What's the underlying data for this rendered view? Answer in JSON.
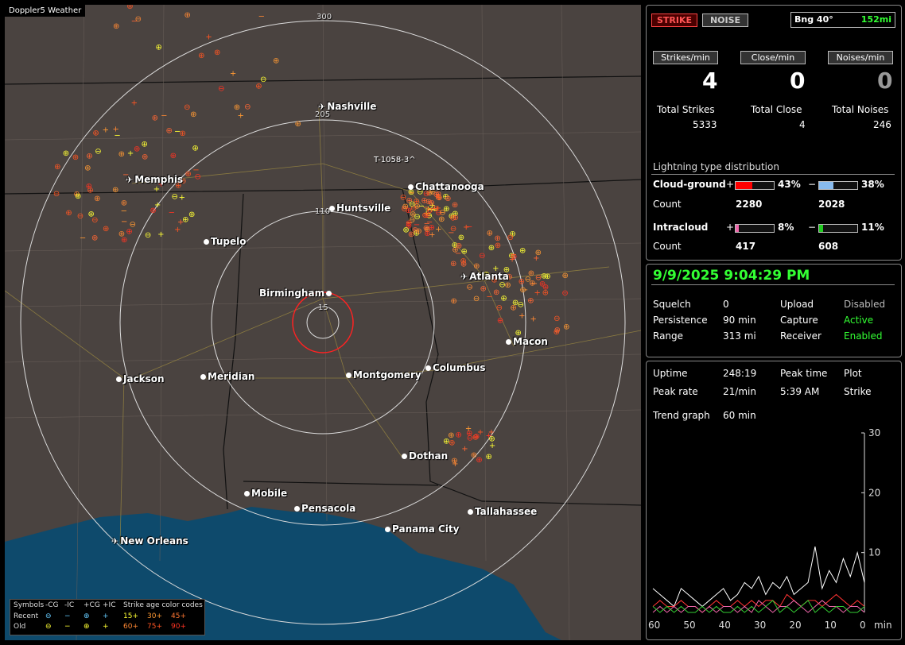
{
  "app_title": "Doppler5 Weather",
  "map": {
    "rings": [
      "300",
      "205",
      "110",
      "15"
    ],
    "marker_label": "T-1058-3^",
    "cities": [
      {
        "name": "Nashville",
        "type": "airport"
      },
      {
        "name": "Memphis",
        "type": "airport"
      },
      {
        "name": "Chattanooga",
        "type": "city"
      },
      {
        "name": "Huntsville",
        "type": "city"
      },
      {
        "name": "Tupelo",
        "type": "city"
      },
      {
        "name": "Atlanta",
        "type": "airport"
      },
      {
        "name": "Birmingham",
        "type": "city"
      },
      {
        "name": "Macon",
        "type": "city"
      },
      {
        "name": "Jackson",
        "type": "city"
      },
      {
        "name": "Meridian",
        "type": "city"
      },
      {
        "name": "Montgomery",
        "type": "city"
      },
      {
        "name": "Columbus",
        "type": "city"
      },
      {
        "name": "Dothan",
        "type": "city"
      },
      {
        "name": "Mobile",
        "type": "city"
      },
      {
        "name": "Pensacola",
        "type": "city"
      },
      {
        "name": "Tallahassee",
        "type": "city"
      },
      {
        "name": "Panama City",
        "type": "city"
      },
      {
        "name": "New Orleans",
        "type": "airport"
      }
    ]
  },
  "legend": {
    "title_symbols": "Symbols",
    "cols": [
      "-CG",
      "-IC",
      "+CG",
      "+IC"
    ],
    "title_age": "Strike age color codes",
    "recent": "Recent",
    "old": "Old",
    "recent_ages": [
      "15+",
      "30+",
      "45+"
    ],
    "old_ages": [
      "60+",
      "75+",
      "90+"
    ],
    "age_colors": [
      "#ffff33",
      "#ff9933",
      "#ff6633",
      "#ff8833",
      "#ff5522",
      "#ff3322"
    ]
  },
  "status": {
    "strike_label": "STRIKE",
    "noise_label": "NOISE",
    "bearing_label": "Bng 40°",
    "bearing_distance": "152mi"
  },
  "rates": {
    "strikes_label": "Strikes/min",
    "close_label": "Close/min",
    "noises_label": "Noises/min",
    "strikes": "4",
    "close": "0",
    "noises": "0"
  },
  "totals": {
    "strikes_label": "Total Strikes",
    "close_label": "Total Close",
    "noises_label": "Total Noises",
    "strikes": "5333",
    "close": "4",
    "noises": "246"
  },
  "distribution": {
    "title": "Lightning type distribution",
    "cg_label": "Cloud-ground",
    "ic_label": "Intracloud",
    "count_label": "Count",
    "plus": "+",
    "minus": "−",
    "cg_plus_pct": "43%",
    "cg_minus_pct": "38%",
    "cg_plus_count": "2280",
    "cg_minus_count": "2028",
    "ic_plus_pct": "8%",
    "ic_minus_pct": "11%",
    "ic_plus_count": "417",
    "ic_minus_count": "608",
    "colors": {
      "cg_plus": "#ff0000",
      "cg_minus": "#88bbee",
      "ic_plus": "#ee66aa",
      "ic_minus": "#22cc22"
    }
  },
  "settings": {
    "datetime": "9/9/2025 9:04:29 PM",
    "squelch_label": "Squelch",
    "squelch": "0",
    "persistence_label": "Persistence",
    "persistence": "90 min",
    "range_label": "Range",
    "range": "313 mi",
    "upload_label": "Upload",
    "upload": "Disabled",
    "capture_label": "Capture",
    "capture": "Active",
    "receiver_label": "Receiver",
    "receiver": "Enabled"
  },
  "stats": {
    "uptime_label": "Uptime",
    "uptime": "248:19",
    "peak_time_label": "Peak time",
    "plot_label": "Plot",
    "peak_rate_label": "Peak rate",
    "peak_rate": "21/min",
    "peak_time": "5:39 AM",
    "plot": "Strike",
    "trend_label": "Trend graph",
    "trend": "60 min"
  },
  "chart_data": {
    "type": "line",
    "title": "",
    "xlabel": "min",
    "ylabel": "",
    "x_ticks": [
      "60",
      "50",
      "40",
      "30",
      "20",
      "10",
      "0"
    ],
    "y_ticks": [
      "30",
      "20",
      "10"
    ],
    "ylim": [
      0,
      30
    ],
    "xlim": [
      60,
      0
    ],
    "x": [
      60,
      58,
      56,
      54,
      52,
      50,
      48,
      46,
      44,
      42,
      40,
      38,
      36,
      34,
      32,
      30,
      28,
      26,
      24,
      22,
      20,
      18,
      16,
      14,
      12,
      10,
      8,
      6,
      4,
      2,
      0
    ],
    "series": [
      {
        "values": [
          4,
          3,
          2,
          1,
          4,
          3,
          2,
          1,
          2,
          3,
          4,
          2,
          3,
          5,
          4,
          6,
          3,
          5,
          4,
          6,
          3,
          4,
          5,
          11,
          4,
          7,
          5,
          9,
          6,
          10,
          5
        ]
      },
      {
        "values": [
          1,
          2,
          1,
          1,
          2,
          1,
          1,
          0,
          1,
          2,
          1,
          1,
          2,
          1,
          2,
          1,
          2,
          2,
          1,
          3,
          2,
          1,
          2,
          2,
          1,
          2,
          3,
          2,
          1,
          2,
          1
        ]
      },
      {
        "values": [
          0,
          1,
          0,
          1,
          0,
          1,
          1,
          0,
          1,
          0,
          1,
          1,
          0,
          1,
          0,
          2,
          1,
          0,
          1,
          1,
          2,
          1,
          0,
          1,
          2,
          1,
          1,
          0,
          1,
          1,
          0
        ]
      },
      {
        "values": [
          1,
          0,
          1,
          0,
          1,
          0,
          0,
          1,
          0,
          1,
          0,
          0,
          1,
          0,
          1,
          0,
          1,
          2,
          0,
          1,
          0,
          1,
          2,
          0,
          1,
          0,
          1,
          1,
          0,
          0,
          1
        ]
      }
    ]
  }
}
